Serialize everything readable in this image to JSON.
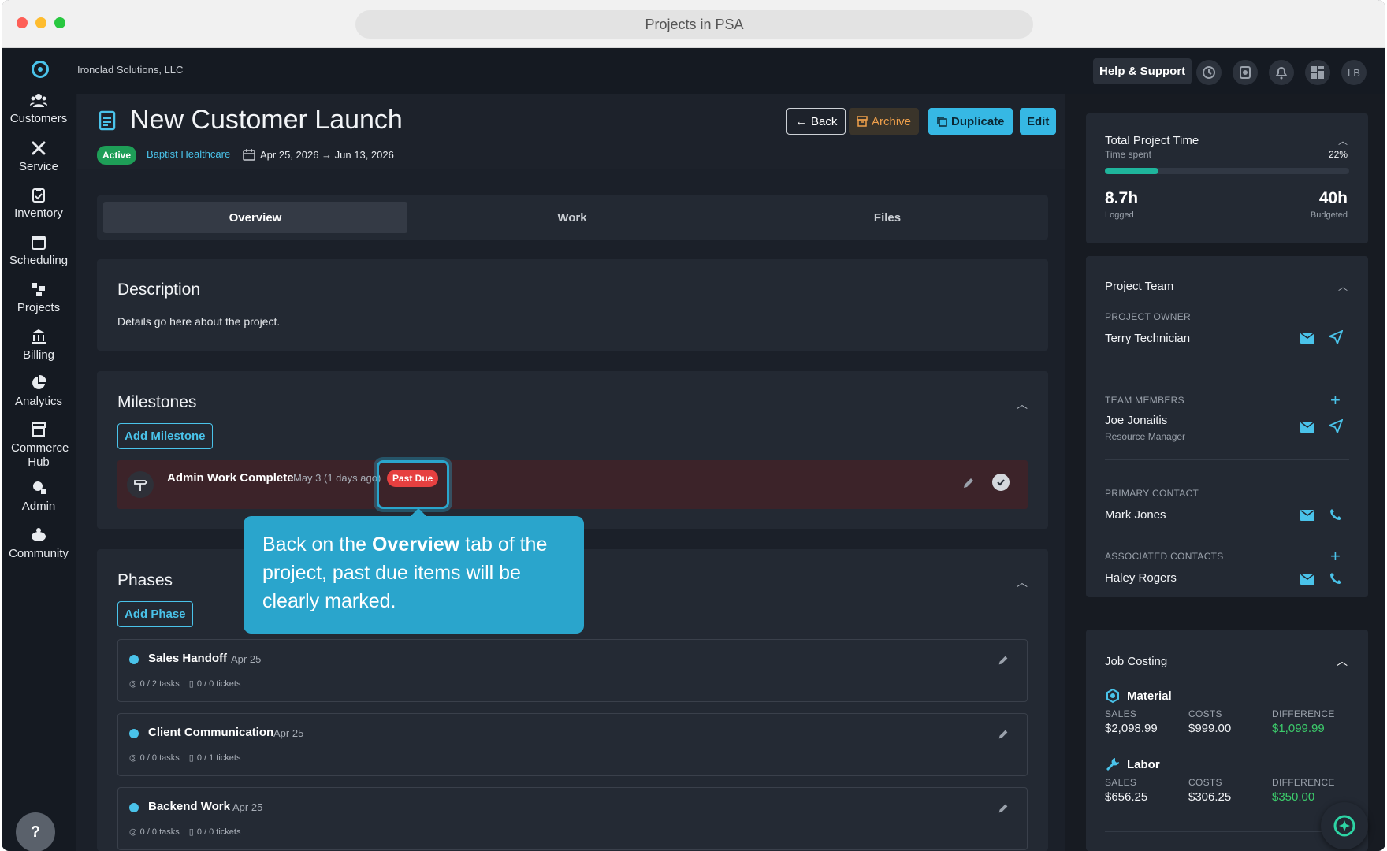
{
  "window": {
    "title": "Projects in PSA"
  },
  "company": "Ironclad Solutions, LLC",
  "nav": [
    {
      "label": "Customers",
      "icon": "users-icon"
    },
    {
      "label": "Service",
      "icon": "tools-icon"
    },
    {
      "label": "Inventory",
      "icon": "clipboard-icon"
    },
    {
      "label": "Scheduling",
      "icon": "calendar-icon"
    },
    {
      "label": "Projects",
      "icon": "projects-icon"
    },
    {
      "label": "Billing",
      "icon": "bank-icon"
    },
    {
      "label": "Analytics",
      "icon": "pie-chart-icon"
    },
    {
      "label": "Commerce Hub",
      "icon": "store-icon"
    },
    {
      "label": "Admin",
      "icon": "admin-icon"
    },
    {
      "label": "Community",
      "icon": "community-icon"
    }
  ],
  "help_label": "?",
  "topbar": {
    "help_support": "Help & Support",
    "avatar": "LB"
  },
  "project": {
    "title": "New Customer Launch",
    "status": "Active",
    "customer": "Baptist Healthcare",
    "dates": "Apr 25, 2026 → Jun 13, 2026"
  },
  "actions": {
    "back": "Back",
    "archive": "Archive",
    "duplicate": "Duplicate",
    "edit": "Edit"
  },
  "tabs": [
    {
      "label": "Overview",
      "active": true
    },
    {
      "label": "Work"
    },
    {
      "label": "Files"
    }
  ],
  "description": {
    "title": "Description",
    "text": "Details go here about the project."
  },
  "milestones": {
    "title": "Milestones",
    "add_label": "Add Milestone",
    "items": [
      {
        "name": "Admin Work Complete",
        "date": "May 3 (1 days ago)",
        "badge": "Past Due"
      }
    ]
  },
  "phases": {
    "title": "Phases",
    "add_label": "Add Phase",
    "items": [
      {
        "name": "Sales Handoff",
        "date": "Apr 25",
        "tasks": "0 / 2 tasks",
        "tickets": "0 / 0 tickets"
      },
      {
        "name": "Client Communication",
        "date": "Apr 25",
        "tasks": "0 / 0 tasks",
        "tickets": "0 / 1 tickets"
      },
      {
        "name": "Backend Work",
        "date": "Apr 25",
        "tasks": "0 / 0 tasks",
        "tickets": "0 / 0 tickets"
      }
    ]
  },
  "tooltip": {
    "pre": "Back on the ",
    "bold": "Overview",
    "post": " tab of the project, past due items will be clearly marked."
  },
  "time": {
    "title": "Total Project Time",
    "subtitle": "Time spent",
    "percent": "22%",
    "progress": 0.22,
    "logged": "8.7h",
    "logged_label": "Logged",
    "budgeted": "40h",
    "budgeted_label": "Budgeted"
  },
  "team": {
    "title": "Project Team",
    "owner_label": "PROJECT OWNER",
    "owner": "Terry Technician",
    "members_label": "TEAM MEMBERS",
    "member": "Joe Jonaitis",
    "member_role": "Resource Manager",
    "primary_label": "PRIMARY CONTACT",
    "primary": "Mark Jones",
    "assoc_label": "ASSOCIATED CONTACTS",
    "assoc": "Haley Rogers"
  },
  "job_costing": {
    "title": "Job Costing",
    "sections": [
      {
        "name": "Material",
        "sales": "$2,098.99",
        "costs": "$999.00",
        "difference": "$1,099.99"
      },
      {
        "name": "Labor",
        "sales": "$656.25",
        "costs": "$306.25",
        "difference": "$350.00"
      }
    ],
    "sales_label": "SALES",
    "costs_label": "COSTS",
    "difference_label": "DIFFERENCE"
  },
  "colors": {
    "accent": "#36b8e4",
    "active": "#1e9e57",
    "past_due": "#e64040",
    "positive": "#3ccb6b",
    "archive": "#f0a04b"
  }
}
